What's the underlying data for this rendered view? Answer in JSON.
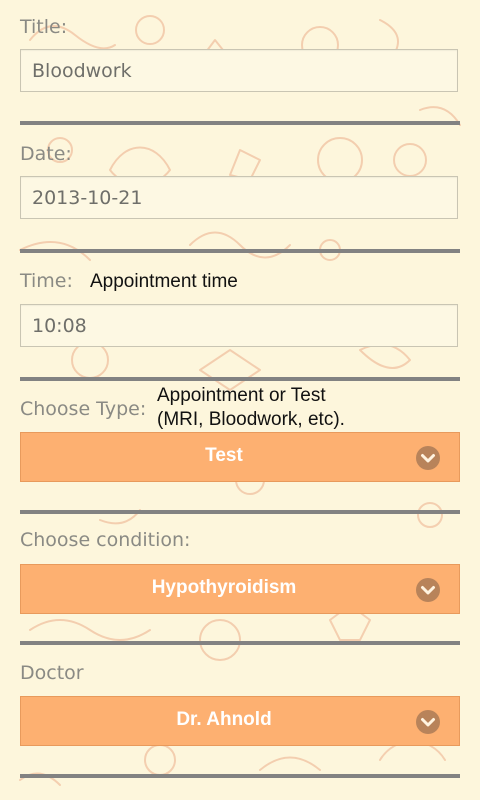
{
  "form": {
    "title": {
      "label": "Title:",
      "value": "Bloodwork"
    },
    "date": {
      "label": "Date:",
      "value": "2013-10-21"
    },
    "time": {
      "label": "Time:",
      "hint": "Appointment time",
      "value": "10:08"
    },
    "type": {
      "label": "Choose Type:",
      "hint_line1": "Appointment or Test",
      "hint_line2": "(MRI, Bloodwork, etc).",
      "selected": "Test",
      "icon": "chevron-down-icon"
    },
    "condition": {
      "label": "Choose condition:",
      "selected": "Hypothyroidism",
      "icon": "chevron-down-icon"
    },
    "doctor": {
      "label": "Doctor",
      "selected": "Dr. Ahnold",
      "icon": "chevron-down-icon"
    }
  },
  "colors": {
    "background": "#fdf6dc",
    "doodles": "#f2c8a8",
    "dropdown": "#fdb071",
    "dropdown_icon": "#b8835a",
    "divider": "#828282",
    "label": "#8a8a84"
  }
}
